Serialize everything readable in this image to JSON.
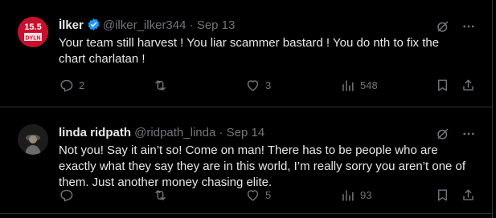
{
  "tweets": [
    {
      "name": "İlker",
      "handle": "@ilker_ilker344",
      "separator": "·",
      "date": "Sep 13",
      "text": "Your team still harvest ! You liar scammer bastard ! You do nth to fix the chart charlatan !",
      "replies": "2",
      "retweets": "",
      "likes": "3",
      "views": "548",
      "avatar_badge": "15.5",
      "avatar_sub": "DYLN"
    },
    {
      "name": "linda ridpath",
      "handle": "@ridpath_linda",
      "separator": "·",
      "date": "Sep 14",
      "text": "Not you! Say it ain’t so! Come on man! There has to be people who are exactly what they say they are in this world, I’m really sorry you aren’t one of them. Just another money chasing elite.",
      "replies": "",
      "retweets": "",
      "likes": "5",
      "views": "93"
    }
  ],
  "icons": {
    "verified": "verified-badge-icon",
    "grok": "grok-icon",
    "more": "more-icon",
    "reply": "reply-icon",
    "retweet": "retweet-icon",
    "like": "heart-icon",
    "views": "views-icon",
    "bookmark": "bookmark-icon",
    "share": "share-icon"
  },
  "colors": {
    "background": "#000000",
    "text": "#e7e9ea",
    "muted": "#71767b",
    "verified": "#1d9bf0",
    "divider": "#2f3336"
  }
}
